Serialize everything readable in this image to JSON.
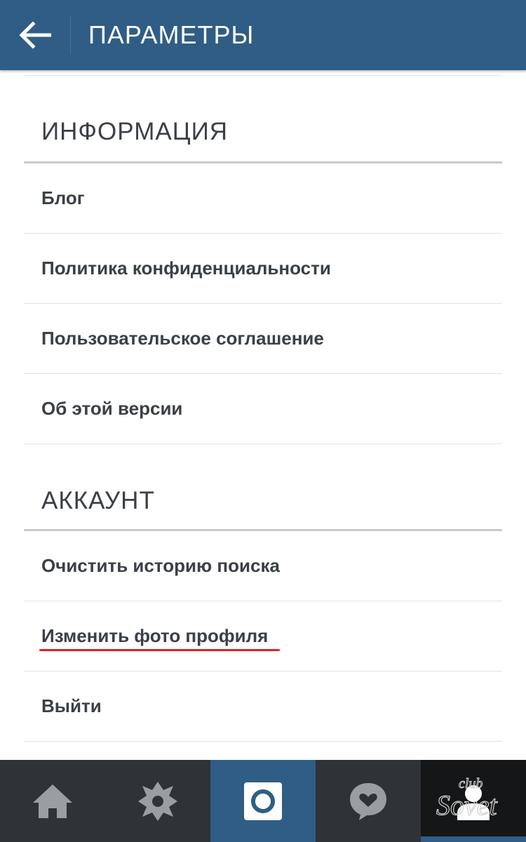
{
  "header": {
    "title": "ПАРАМЕТРЫ",
    "back_icon": "arrow-left-icon"
  },
  "sections": {
    "info": {
      "title": "ИНФОРМАЦИЯ",
      "items": [
        {
          "label": "Блог"
        },
        {
          "label": "Политика конфиденциальности"
        },
        {
          "label": "Пользовательское соглашение"
        },
        {
          "label": "Об этой версии"
        }
      ]
    },
    "account": {
      "title": "АККАУНТ",
      "items": [
        {
          "label": "Очистить историю поиска"
        },
        {
          "label": "Изменить фото профиля"
        },
        {
          "label": "Выйти"
        }
      ]
    }
  },
  "annotation": {
    "underlined_item": "Изменить фото профиля",
    "underline_color": "#e31e24"
  },
  "bottom_nav": {
    "tabs": [
      {
        "icon": "home-icon"
      },
      {
        "icon": "explore-icon"
      },
      {
        "icon": "camera-icon",
        "active": true
      },
      {
        "icon": "activity-heart-icon"
      },
      {
        "icon": "profile-icon"
      }
    ]
  },
  "watermark": {
    "text": "club Sovet"
  },
  "colors": {
    "header_bg": "#2f5d86",
    "nav_bg": "#2f3236",
    "text": "#3b4047",
    "accent": "#e31e24"
  }
}
